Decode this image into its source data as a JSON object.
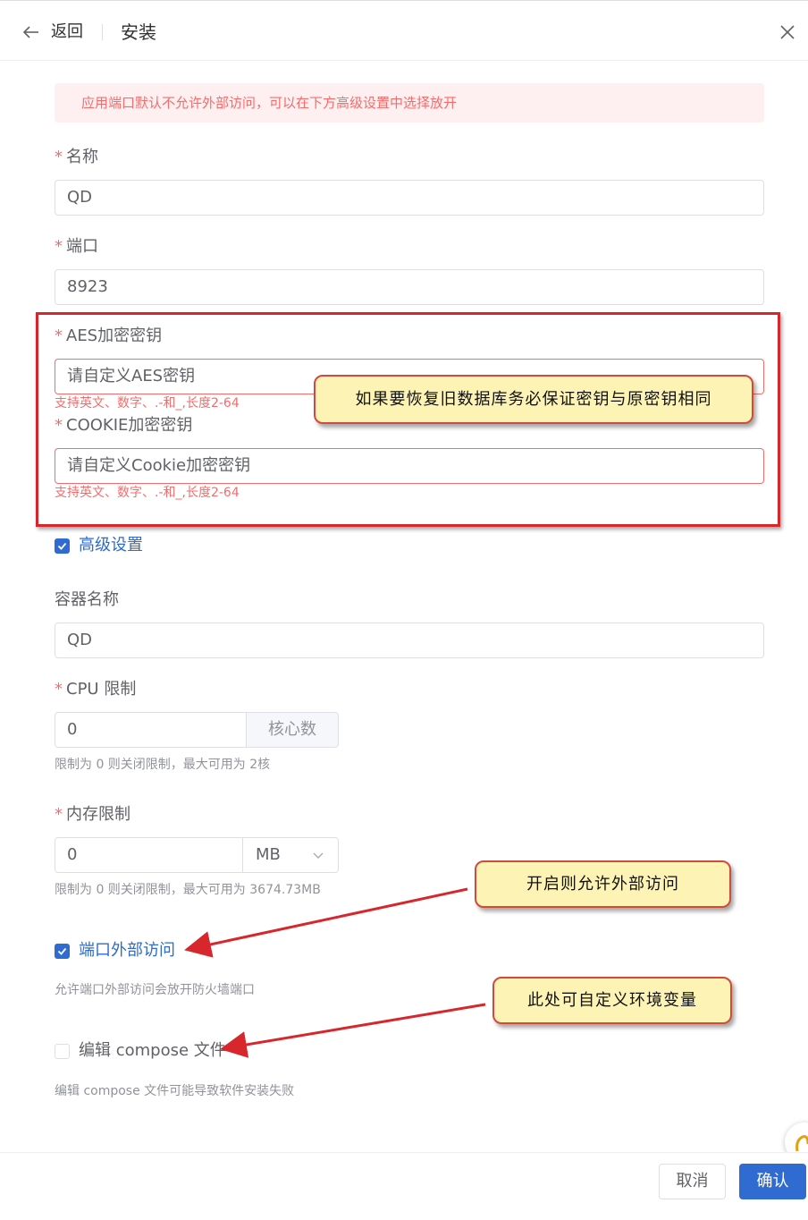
{
  "header": {
    "back_label": "返回",
    "title": "安装"
  },
  "alert": {
    "text": "应用端口默认不允许外部访问，可以在下方高级设置中选择放开"
  },
  "form": {
    "name": {
      "label": "名称",
      "value": "QD"
    },
    "port": {
      "label": "端口",
      "value": "8923"
    },
    "aes": {
      "label": "AES加密密钥",
      "placeholder": "请自定义AES密钥",
      "error": "支持英文、数字、.-和_,长度2-64"
    },
    "cookie": {
      "label": "COOKIE加密密钥",
      "placeholder": "请自定义Cookie加密密钥",
      "error": "支持英文、数字、.-和_,长度2-64"
    },
    "advanced": {
      "label": "高级设置",
      "checked": true
    },
    "container_name": {
      "label": "容器名称",
      "value": "QD"
    },
    "cpu": {
      "label": "CPU 限制",
      "value": "0",
      "unit": "核心数",
      "hint": "限制为 0 则关闭限制，最大可用为 2核"
    },
    "memory": {
      "label": "内存限制",
      "value": "0",
      "unit": "MB",
      "hint": "限制为 0 则关闭限制，最大可用为 3674.73MB"
    },
    "port_external": {
      "label": "端口外部访问",
      "checked": true,
      "hint": "允许端口外部访问会放开防火墙端口"
    },
    "edit_compose": {
      "label": "编辑 compose 文件",
      "checked": false,
      "hint": "编辑 compose 文件可能导致软件安装失败"
    }
  },
  "annotations": {
    "key_note": "如果要恢复旧数据库务必保证密钥与原密钥相同",
    "external_note": "开启则允许外部访问",
    "env_note": "此处可自定义环境变量",
    "highlight_color": "#d8262d",
    "callout_bg": "#fdf3b4"
  },
  "footer": {
    "cancel_label": "取消",
    "confirm_label": "确认"
  },
  "colors": {
    "primary": "#2f6bd0",
    "danger": "#f56c6c"
  }
}
